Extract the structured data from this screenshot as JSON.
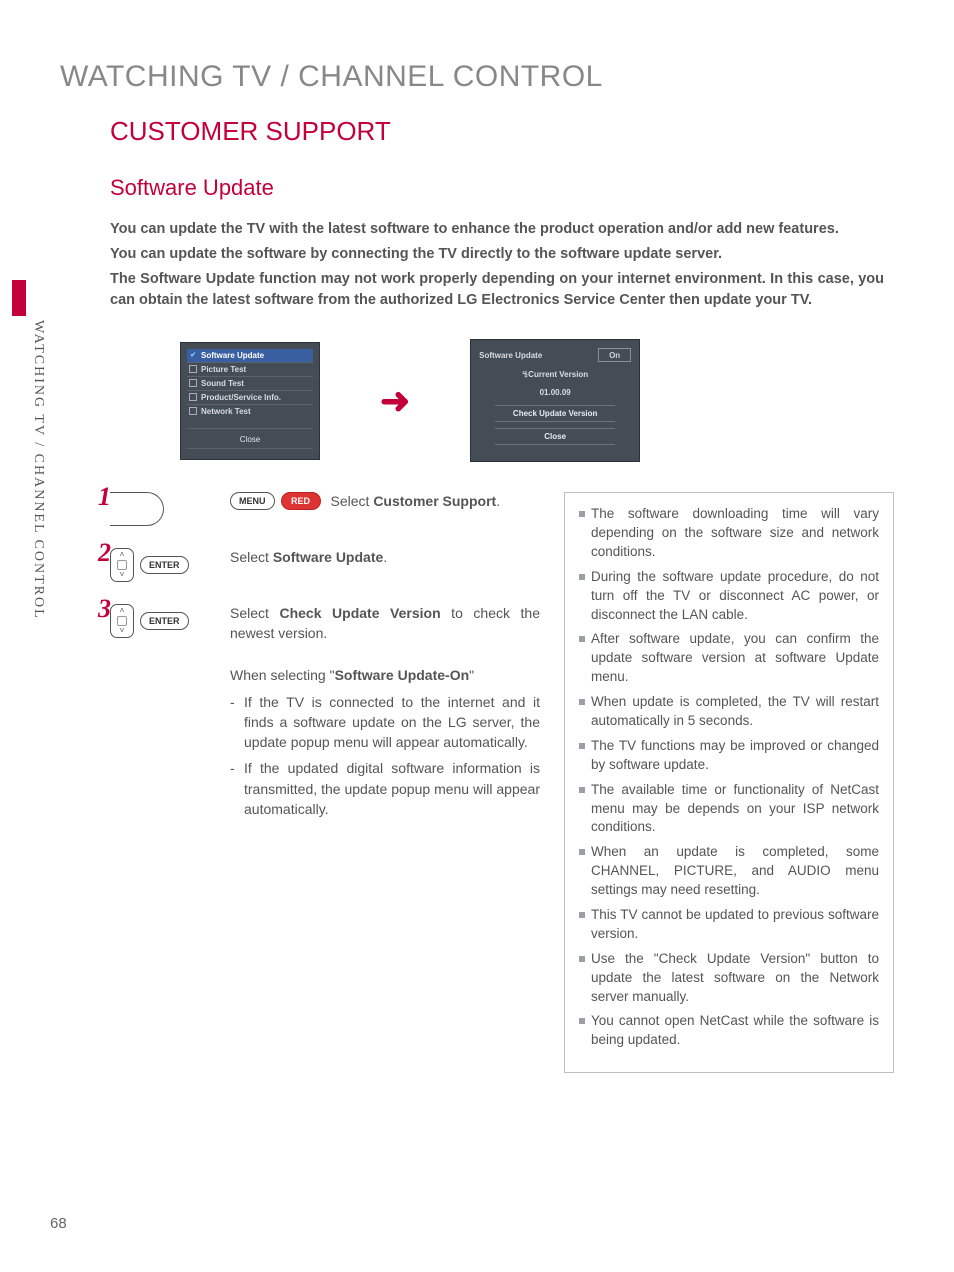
{
  "page_number": "68",
  "side_label": "WATCHING TV / CHANNEL CONTROL",
  "chapter_title": "WATCHING TV / CHANNEL CONTROL",
  "section_title": "CUSTOMER SUPPORT",
  "subsection_title": "Software Update",
  "intro": {
    "p1": "You can update the TV with the latest software to enhance the product operation and/or add new features.",
    "p2": "You can update the software by connecting the TV directly to the software update server.",
    "p3": "The Software Update function may not work properly depending on your internet environment. In this case, you can obtain the latest software from the authorized LG Electronics Service Center then update your TV."
  },
  "menu_panel": {
    "items": [
      {
        "label": "Software Update",
        "selected": true
      },
      {
        "label": "Picture Test",
        "selected": false
      },
      {
        "label": "Sound Test",
        "selected": false
      },
      {
        "label": "Product/Service Info.",
        "selected": false
      },
      {
        "label": "Network Test",
        "selected": false
      }
    ],
    "close": "Close"
  },
  "update_panel": {
    "title": "Software Update",
    "state": "On",
    "current_version_label": "ꔈCurrent Version",
    "current_version": "01.00.09",
    "check_btn": "Check Update Version",
    "close": "Close"
  },
  "steps": {
    "s1": {
      "num": "1",
      "keys": [
        "MENU",
        "RED"
      ],
      "text_pre": "Select ",
      "bold": "Customer Support",
      "text_post": "."
    },
    "s2": {
      "num": "2",
      "keys": [
        "ENTER"
      ],
      "text_pre": "Select ",
      "bold": "Software Update",
      "text_post": "."
    },
    "s3": {
      "num": "3",
      "keys": [
        "ENTER"
      ],
      "text_pre": "Select ",
      "bold": "Check Update Version",
      "text_post": " to check the newest version."
    }
  },
  "when_selecting": {
    "heading_pre": "When selecting \"",
    "heading_bold": "Software Update-On",
    "heading_post": "\"",
    "b1": "If the TV is connected to the internet and it finds a software update on the LG server, the update popup menu will appear automatically.",
    "b2": "If the updated digital software information is transmitted, the update popup menu will appear automatically."
  },
  "notes": {
    "n1": "The software downloading time will vary depending on the software size and network conditions.",
    "n2": "During the software update procedure, do not turn off the TV or disconnect AC power, or disconnect the LAN cable.",
    "n3": "After software update, you can confirm the update software version at software Update menu.",
    "n4": "When update is completed, the TV will restart automatically in 5 seconds.",
    "n5": "The TV functions may be improved or changed by software update.",
    "n6": "The available time or functionality of NetCast menu may be depends on your ISP network conditions.",
    "n7": "When an update is completed, some CHANNEL, PICTURE, and AUDIO menu settings may need resetting.",
    "n8": "This TV cannot be updated to previous software version.",
    "n9": "Use the \"Check Update Version\" button to update the latest software on the Network server manually.",
    "n10": "You cannot open NetCast while the software is being updated."
  }
}
